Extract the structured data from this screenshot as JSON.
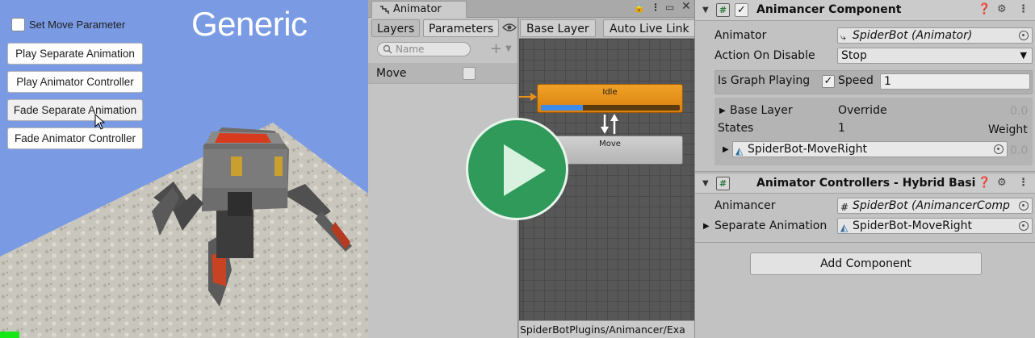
{
  "game": {
    "title": "Generic",
    "checkbox_label": "Set Move Parameter",
    "buttons": [
      "Play Separate Animation",
      "Play Animator Controller",
      "Fade Separate Animation",
      "Fade Animator Controller"
    ]
  },
  "animator": {
    "tab_label": "Animator",
    "sub_tabs": [
      "Layers",
      "Parameters"
    ],
    "search_placeholder": "Name",
    "parameter": {
      "name": "Move",
      "value": false
    },
    "breadcrumb": "Base Layer",
    "live_link": "Auto Live Link",
    "states": {
      "idle": "Idle",
      "move": "Move"
    },
    "idle_progress": 0.3,
    "footer_path": "SpiderBotPlugins/Animancer/Exa"
  },
  "inspector": {
    "animancer_component": {
      "title": "Animancer Component",
      "animator_label": "Animator",
      "animator_value": "SpiderBot (Animator)",
      "action_label": "Action On Disable",
      "action_value": "Stop",
      "graph_playing_label": "Is Graph Playing",
      "speed_label": "Speed",
      "speed_value": "1",
      "base_layer_label": "Base Layer",
      "base_layer_mode": "Override",
      "base_layer_weight": "0.0",
      "states_label": "States",
      "states_count": "1",
      "weight_label": "Weight",
      "state_name": "SpiderBot-MoveRight",
      "state_weight": "0.0"
    },
    "hybrid_component": {
      "title": "Animator Controllers - Hybrid Basi",
      "animancer_label": "Animancer",
      "animancer_value": "SpiderBot (AnimancerComp",
      "separate_label": "Separate Animation",
      "separate_value": "SpiderBot-MoveRight"
    },
    "add_component": "Add Component"
  },
  "colors": {
    "sky": "#7a9be3",
    "idle_node": "#e58f1a",
    "play_overlay": "#2f9a5a",
    "progress": "#3d8be8"
  }
}
